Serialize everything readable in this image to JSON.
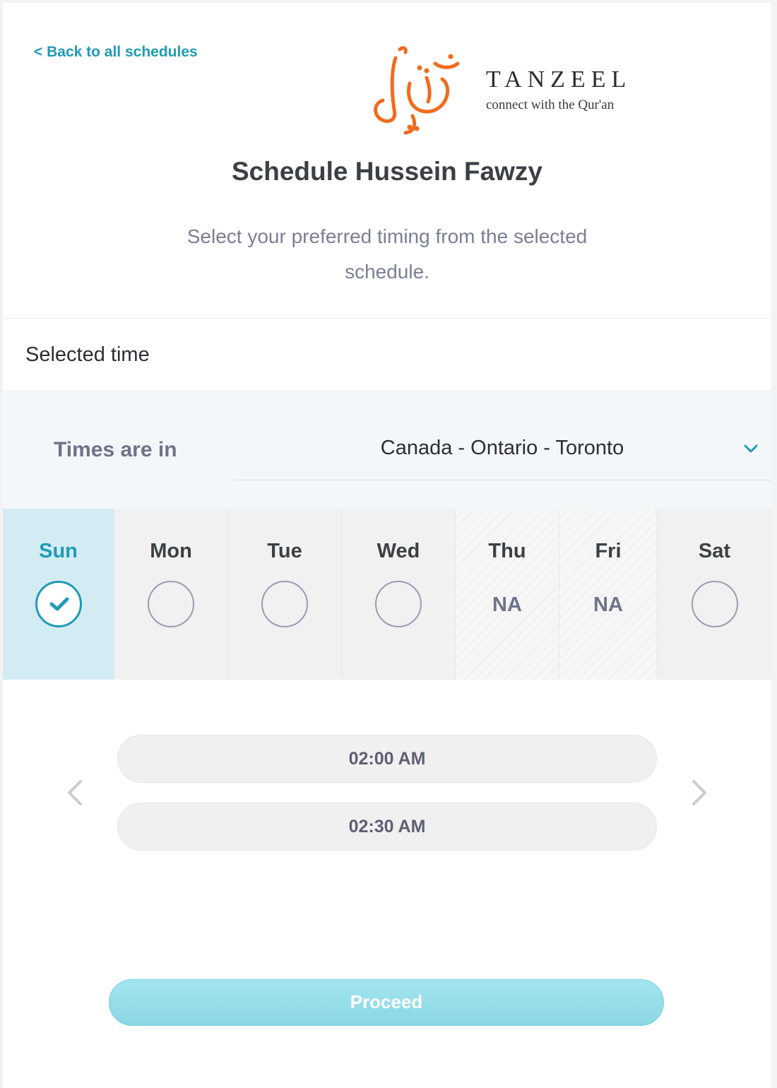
{
  "header": {
    "back_link": "< Back to all schedules",
    "logo": {
      "name": "TANZEEL",
      "tagline": "connect with the Qur'an",
      "calligraphy_text": "تنزيل",
      "calligraphy_color": "#f26b1d"
    }
  },
  "title": "Schedule Hussein Fawzy",
  "subtitle": "Select your preferred timing from the selected schedule.",
  "selected_time_label": "Selected time",
  "timezone": {
    "label": "Times are in",
    "value": "Canada - Ontario - Toronto",
    "icon": "chevron-down-icon"
  },
  "days": [
    {
      "label": "Sun",
      "state": "selected"
    },
    {
      "label": "Mon",
      "state": "available"
    },
    {
      "label": "Tue",
      "state": "available"
    },
    {
      "label": "Wed",
      "state": "available"
    },
    {
      "label": "Thu",
      "state": "na",
      "status": "NA"
    },
    {
      "label": "Fri",
      "state": "na",
      "status": "NA"
    },
    {
      "label": "Sat",
      "state": "available"
    }
  ],
  "time_slots": [
    "02:00 AM",
    "02:30 AM"
  ],
  "navigation": {
    "prev_icon": "chevron-left-icon",
    "next_icon": "chevron-right-icon"
  },
  "proceed_label": "Proceed",
  "colors": {
    "accent": "#1f9bb5",
    "selected_day_bg": "#d3ecf3",
    "proceed_button": "#9ce0ea",
    "logo_orange": "#f26b1d"
  }
}
